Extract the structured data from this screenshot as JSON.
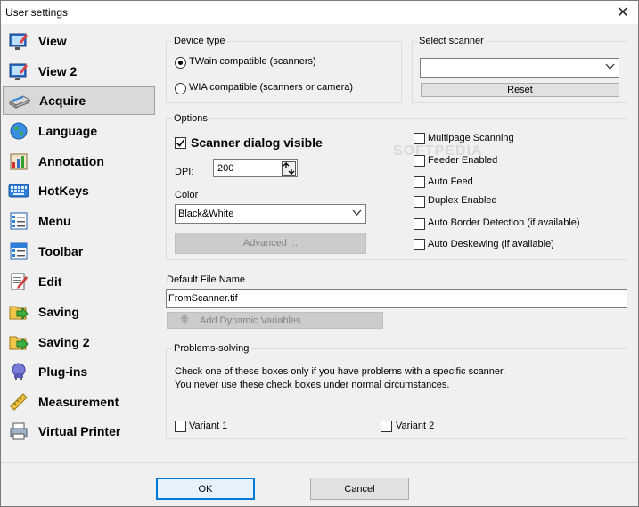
{
  "window": {
    "title": "User settings"
  },
  "sidebar": {
    "items": [
      {
        "label": "View"
      },
      {
        "label": "View 2"
      },
      {
        "label": "Acquire"
      },
      {
        "label": "Language"
      },
      {
        "label": "Annotation"
      },
      {
        "label": "HotKeys"
      },
      {
        "label": "Menu"
      },
      {
        "label": "Toolbar"
      },
      {
        "label": "Edit"
      },
      {
        "label": "Saving"
      },
      {
        "label": "Saving 2"
      },
      {
        "label": "Plug-ins"
      },
      {
        "label": "Measurement"
      },
      {
        "label": "Virtual Printer"
      }
    ],
    "selected": "Acquire"
  },
  "device_type": {
    "title": "Device type",
    "twain_label": "TWain compatible (scanners)",
    "wia_label": "WIA compatible (scanners or camera)",
    "selected": "twain"
  },
  "select_scanner": {
    "title": "Select scanner",
    "value": "",
    "reset_label": "Reset"
  },
  "options": {
    "title": "Options",
    "scanner_dialog_label": "Scanner dialog visible",
    "scanner_dialog_checked": true,
    "dpi_label": "DPI:",
    "dpi_value": "200",
    "color_label": "Color",
    "color_value": "Black&White",
    "advanced_label": "Advanced ...",
    "checks": [
      {
        "label": "Multipage Scanning",
        "checked": false
      },
      {
        "label": "Feeder Enabled",
        "checked": false
      },
      {
        "label": "Auto Feed",
        "checked": false
      },
      {
        "label": "Duplex Enabled",
        "checked": false
      },
      {
        "label": "Auto Border Detection (if available)",
        "checked": false
      },
      {
        "label": "Auto Deskewing (if available)",
        "checked": false
      }
    ]
  },
  "file_name": {
    "label": "Default File Name",
    "value": "FromScanner.tif",
    "dynamic_label": "Add Dynamic Variables ..."
  },
  "problems": {
    "title": "Problems-solving",
    "line1": "Check one of these boxes only if you have problems with a specific scanner.",
    "line2": "You never use these check boxes under normal circumstances.",
    "variant1": "Variant 1",
    "variant2": "Variant 2"
  },
  "footer": {
    "ok_label": "OK",
    "cancel_label": "Cancel"
  },
  "watermark": "SOFTPEDIA"
}
